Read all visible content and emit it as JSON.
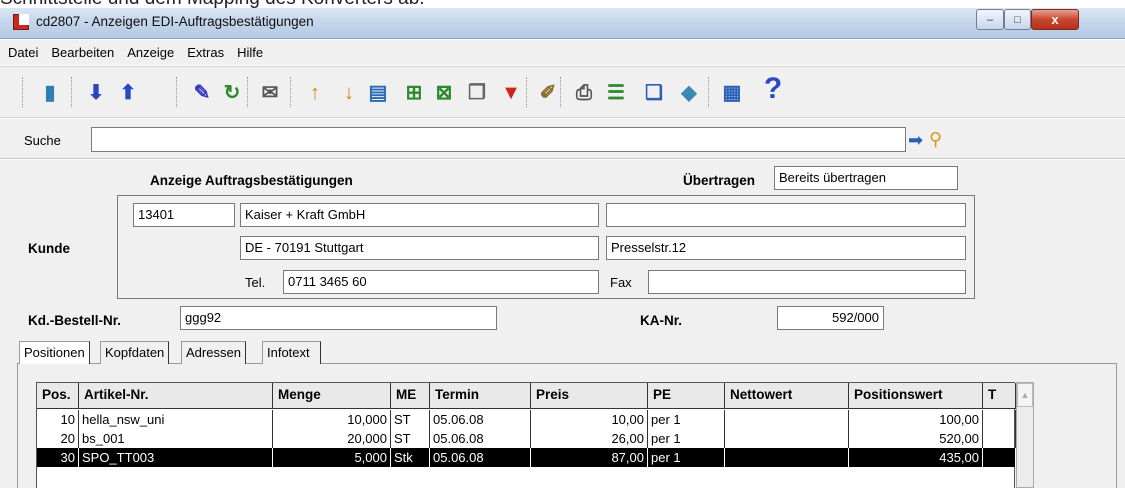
{
  "heading_cut": "Schnittstelle und dem Mapping des Konverters ab.",
  "window": {
    "title": "cd2807 - Anzeigen EDI-Auftragsbestätigungen",
    "min_label": "–",
    "max_label": "□",
    "close_label": "x"
  },
  "menu": [
    "Datei",
    "Bearbeiten",
    "Anzeige",
    "Extras",
    "Hilfe"
  ],
  "toolbar": [
    {
      "name": "exit-icon",
      "glyph": "▮",
      "color": "#2f7fb4"
    },
    {
      "name": "arrow-down-icon",
      "glyph": "⬇",
      "color": "#2a48c4"
    },
    {
      "name": "arrow-up-icon",
      "glyph": "⬆",
      "color": "#2a48c4"
    },
    {
      "name": "edit-pencil-icon",
      "glyph": "✎",
      "color": "#3a3ac0"
    },
    {
      "name": "refresh-icon",
      "glyph": "↻",
      "color": "#2b8a2b"
    },
    {
      "name": "mail-icon",
      "glyph": "✉",
      "color": "#555"
    },
    {
      "name": "sort-ascending-icon",
      "glyph": "↑",
      "color": "#d08a10"
    },
    {
      "name": "sort-descending-icon",
      "glyph": "↓",
      "color": "#d08a10"
    },
    {
      "name": "number-format-icon",
      "glyph": "▤",
      "color": "#2b6ab8"
    },
    {
      "name": "export-icon",
      "glyph": "⊞",
      "color": "#2b8a2b"
    },
    {
      "name": "excel-icon",
      "glyph": "⊠",
      "color": "#2b8a2b"
    },
    {
      "name": "copy-icon",
      "glyph": "❐",
      "color": "#666"
    },
    {
      "name": "filter-icon",
      "glyph": "▼",
      "color": "#c7281e"
    },
    {
      "name": "properties-icon",
      "glyph": "✐",
      "color": "#8a6a2a"
    },
    {
      "name": "printer-icon",
      "glyph": "⎙",
      "color": "#555"
    },
    {
      "name": "list-import-icon",
      "glyph": "☰",
      "color": "#2b8a2b"
    },
    {
      "name": "windows-icon",
      "glyph": "❏",
      "color": "#2b5fb8"
    },
    {
      "name": "book-icon",
      "glyph": "◆",
      "color": "#3a8ab0"
    },
    {
      "name": "calendar-icon",
      "glyph": "▦",
      "color": "#2b5fb8"
    },
    {
      "name": "help-icon",
      "glyph": "?",
      "color": "#2a48c4"
    }
  ],
  "search": {
    "label": "Suche",
    "value": ""
  },
  "form": {
    "section_title": "Anzeige Auftragsbestätigungen",
    "transfer_label": "Übertragen",
    "transfer_value": "Bereits übertragen",
    "kunde_label": "Kunde",
    "customer_no": "13401",
    "customer_name": "Kaiser + Kraft GmbH",
    "extra_field": "",
    "city": "DE - 70191 Stuttgart",
    "street": "Presselstr.12",
    "tel_label": "Tel.",
    "tel": "0711 3465 60",
    "fax_label": "Fax",
    "fax": "",
    "order_no_label": "Kd.-Bestell-Nr.",
    "order_no": "ggg92",
    "ka_label": "KA-Nr.",
    "ka_no": "592/000"
  },
  "tabs": [
    "Positionen",
    "Kopfdaten",
    "Adressen",
    "Infotext"
  ],
  "table": {
    "headers": [
      "Pos.",
      "Artikel-Nr.",
      "Menge",
      "ME",
      "Termin",
      "Preis",
      "PE",
      "Nettowert",
      "Positionswert",
      "T"
    ],
    "rows": [
      [
        "10",
        "hella_nsw_uni",
        "10,000",
        "ST",
        "05.06.08",
        "10,00",
        "per 1",
        "",
        "100,00",
        ""
      ],
      [
        "20",
        "bs_001",
        "20,000",
        "ST",
        "05.06.08",
        "26,00",
        "per 1",
        "",
        "520,00",
        ""
      ],
      [
        "30",
        "SPO_TT003",
        "5,000",
        "Stk",
        "05.06.08",
        "87,00",
        "per 1",
        "",
        "435,00",
        ""
      ]
    ],
    "selected_row": 2
  },
  "scroll_up_glyph": "▲"
}
